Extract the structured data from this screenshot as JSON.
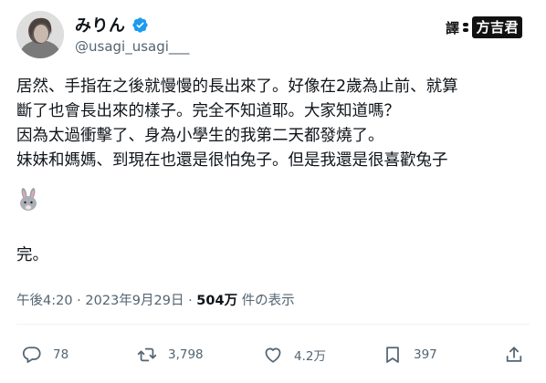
{
  "author": {
    "display_name": "みりん",
    "handle": "@usagi_usagi___",
    "verified": true,
    "avatar": "avatar-photo"
  },
  "translator_badge": {
    "prefix": "譯",
    "name": "方吉君"
  },
  "post": {
    "lines": [
      "居然、手指在之後就慢慢的長出來了。好像在2歲為止前、就算",
      "斷了也會長出來的樣子。完全不知道耶。大家知道嗎？",
      "因為太過衝擊了、身為小學生的我第二天都發燒了。",
      "妹妹和媽媽、到現在也還是很怕兔子。但是我還是很喜歡兔子"
    ],
    "emoji": "rabbit-face",
    "ending": "完。"
  },
  "meta": {
    "time": "午後4:20",
    "separator": "·",
    "date": "2023年9月29日",
    "views_count": "504万",
    "views_label": "件の表示"
  },
  "actions": {
    "reply": {
      "icon": "reply-icon",
      "count": "78"
    },
    "retweet": {
      "icon": "retweet-icon",
      "count": "3,798"
    },
    "like": {
      "icon": "heart-icon",
      "count": "4.2万"
    },
    "bookmark": {
      "icon": "bookmark-icon",
      "count": "397"
    },
    "share": {
      "icon": "share-icon"
    }
  },
  "colors": {
    "text": "#0f1419",
    "secondary": "#536471",
    "verified": "#1d9bf0",
    "divider": "#eff3f4"
  }
}
